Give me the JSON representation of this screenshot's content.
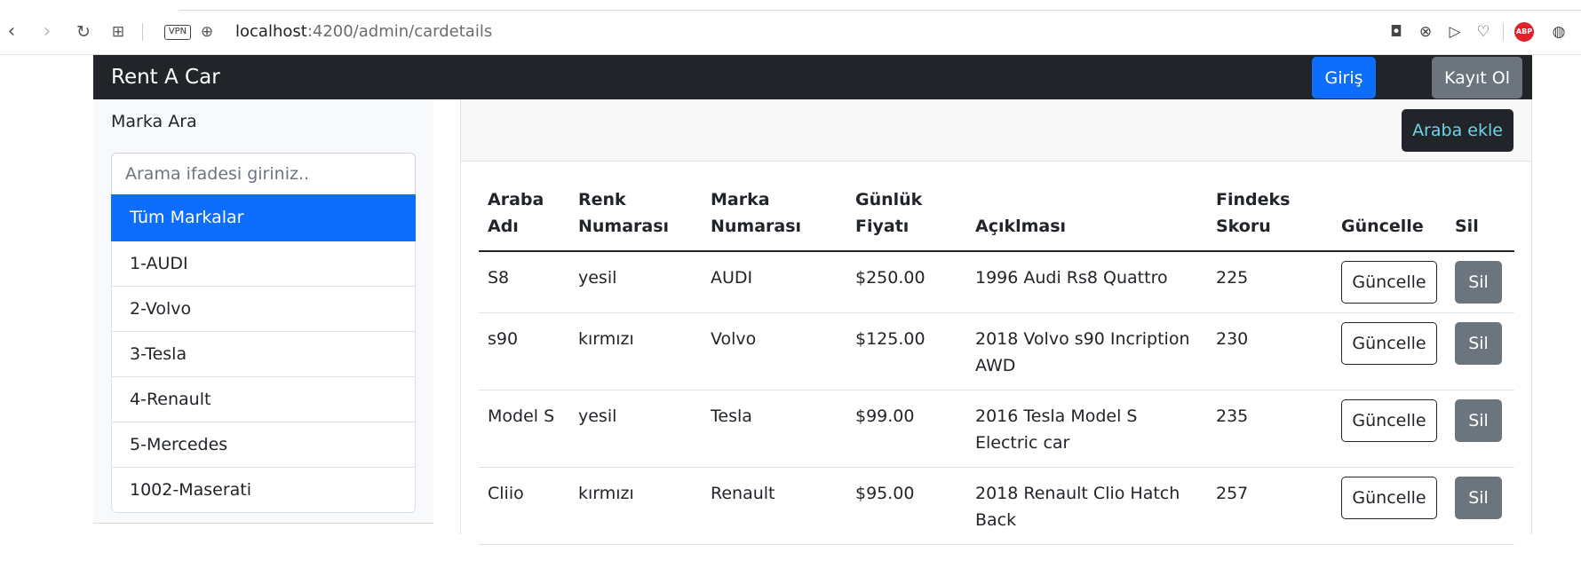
{
  "browser": {
    "url_host": "localhost",
    "url_path": ":4200/admin/cardetails",
    "vpn_label": "VPN",
    "icons": [
      "back-icon",
      "forward-icon",
      "reload-icon",
      "tabs-grid-icon",
      "vpn-icon",
      "globe-icon",
      "camera-icon",
      "shield-icon",
      "send-icon",
      "heart-icon",
      "adblock-icon",
      "extension-icon"
    ],
    "abp_label": "ABP"
  },
  "navbar": {
    "brand": "Rent A Car",
    "login_label": "Giriş",
    "register_label": "Kayıt Ol",
    "bg_color": "#212529"
  },
  "sidebar": {
    "title": "Marka Ara",
    "search_placeholder": "Arama ifadesi giriniz..",
    "items": [
      {
        "label": "Tüm Markalar",
        "active": true
      },
      {
        "label": "1-AUDI"
      },
      {
        "label": "2-Volvo"
      },
      {
        "label": "3-Tesla"
      },
      {
        "label": "4-Renault"
      },
      {
        "label": "5-Mercedes"
      },
      {
        "label": "1002-Maserati"
      }
    ]
  },
  "main": {
    "add_label": "Araba ekle",
    "headers": {
      "name": [
        "Araba",
        "Adı"
      ],
      "color": [
        "Renk",
        "Numarası"
      ],
      "brand": [
        "Marka",
        "Numarası"
      ],
      "price": [
        "Günlük",
        "Fiyatı"
      ],
      "desc": [
        "",
        "Açıklması"
      ],
      "findeks": [
        "Findeks",
        "Skoru"
      ],
      "update": [
        "",
        "Güncelle"
      ],
      "delete": [
        "",
        "Sil"
      ]
    },
    "rows": [
      {
        "name": "S8",
        "color": "yesil",
        "brand": "AUDI",
        "price": "$250.00",
        "desc": "1996 Audi Rs8 Quattro",
        "findeks": "225",
        "update": "Güncelle",
        "delete": "Sil"
      },
      {
        "name": "s90",
        "color": "kırmızı",
        "brand": "Volvo",
        "price": "$125.00",
        "desc": "2018 Volvo s90 Incription AWD",
        "findeks": "230",
        "update": "Güncelle",
        "delete": "Sil"
      },
      {
        "name": "Model S",
        "color": "yesil",
        "brand": "Tesla",
        "price": "$99.00",
        "desc": "2016 Tesla Model S Electric car",
        "findeks": "235",
        "update": "Güncelle",
        "delete": "Sil"
      },
      {
        "name": "Cliio",
        "color": "kırmızı",
        "brand": "Renault",
        "price": "$95.00",
        "desc": "2018 Renault Clio Hatch Back",
        "findeks": "257",
        "update": "Güncelle",
        "delete": "Sil"
      }
    ],
    "primary_color": "#0d6efd",
    "secondary_color": "#6c757d"
  }
}
